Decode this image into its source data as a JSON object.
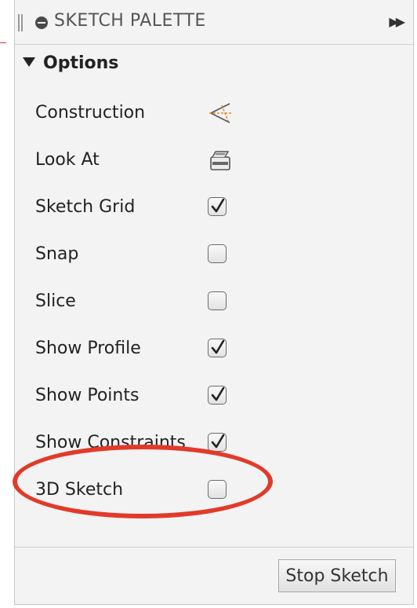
{
  "palette": {
    "title": "SKETCH PALETTE",
    "expand_glyph": "▶▶"
  },
  "options": {
    "section_label": "Options",
    "rows": [
      {
        "label": "Construction",
        "control": "icon",
        "icon": "construction-icon"
      },
      {
        "label": "Look At",
        "control": "icon",
        "icon": "look-at-icon"
      },
      {
        "label": "Sketch Grid",
        "control": "checkbox",
        "checked": true
      },
      {
        "label": "Snap",
        "control": "checkbox",
        "checked": false
      },
      {
        "label": "Slice",
        "control": "checkbox",
        "checked": false
      },
      {
        "label": "Show Profile",
        "control": "checkbox",
        "checked": true
      },
      {
        "label": "Show Points",
        "control": "checkbox",
        "checked": true
      },
      {
        "label": "Show Constraints",
        "control": "checkbox",
        "checked": true
      },
      {
        "label": "3D Sketch",
        "control": "checkbox",
        "checked": false
      }
    ]
  },
  "footer": {
    "stop_label": "Stop Sketch"
  },
  "colors": {
    "annotation": "#e23a2a",
    "panel_bg": "#f3f3f3",
    "construction_accent": "#e08a2a"
  }
}
